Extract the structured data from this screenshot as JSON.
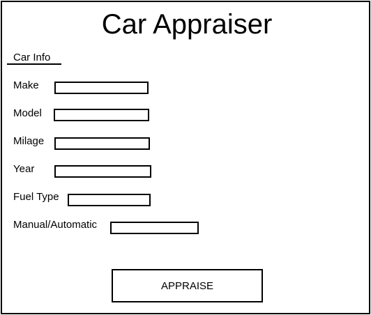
{
  "app": {
    "title": "Car Appraiser"
  },
  "section": {
    "label": "Car Info"
  },
  "fields": {
    "make": {
      "label": "Make",
      "value": ""
    },
    "model": {
      "label": "Model",
      "value": ""
    },
    "milage": {
      "label": "Milage",
      "value": ""
    },
    "year": {
      "label": "Year",
      "value": ""
    },
    "fuel_type": {
      "label": "Fuel Type",
      "value": ""
    },
    "transmission": {
      "label": "Manual/Automatic",
      "value": ""
    }
  },
  "actions": {
    "appraise_label": "APPRAISE"
  }
}
